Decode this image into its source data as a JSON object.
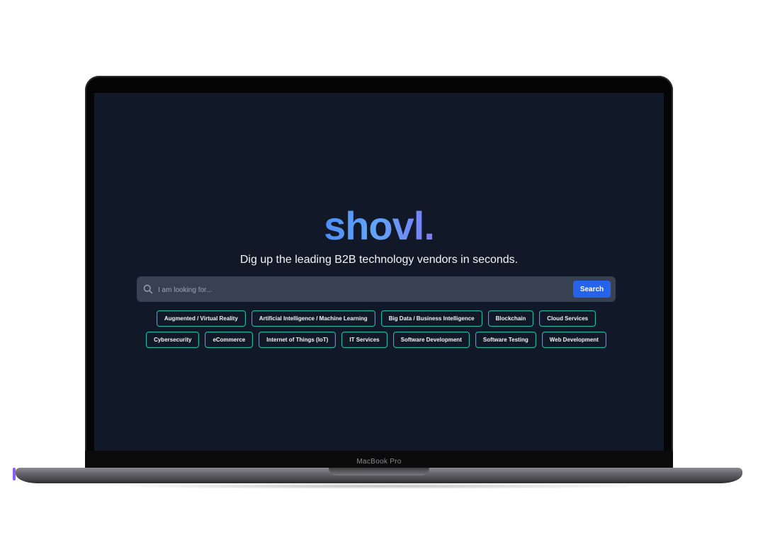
{
  "device": {
    "model_label": "MacBook Pro"
  },
  "brand": {
    "logo_text": "shovl."
  },
  "hero": {
    "tagline": "Dig up the leading B2B technology vendors in seconds."
  },
  "search": {
    "placeholder": "I am looking for...",
    "value": "",
    "button_label": "Search"
  },
  "categories": [
    "Augmented / Virtual Reality",
    "Artificial Intelligence / Machine Learning",
    "Big Data / Business Intelligence",
    "Blockchain",
    "Cloud Services",
    "Cybersecurity",
    "eCommerce",
    "Internet of Things (IoT)",
    "IT Services",
    "Software Development",
    "Software Testing",
    "Web Development"
  ],
  "colors": {
    "screen_background": "#111827",
    "accent_blue": "#2563eb",
    "tag_border": "#22b8a6",
    "search_background": "#374151"
  }
}
